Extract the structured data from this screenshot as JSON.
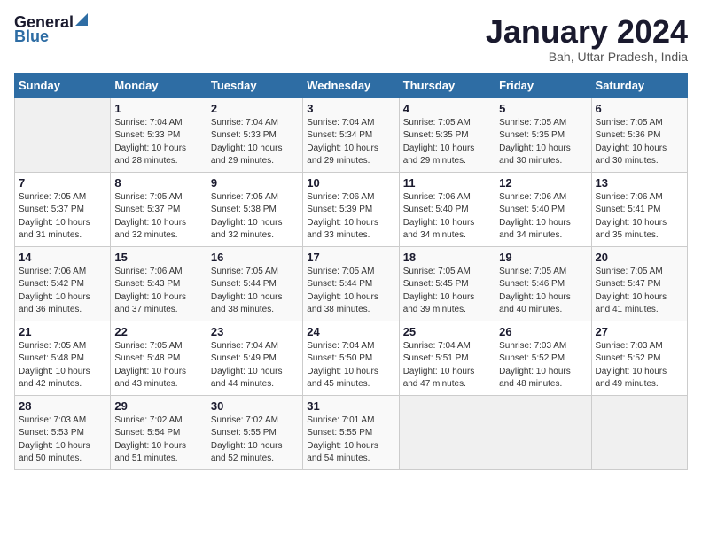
{
  "logo": {
    "general": "General",
    "blue": "Blue"
  },
  "header": {
    "month": "January 2024",
    "location": "Bah, Uttar Pradesh, India"
  },
  "columns": [
    "Sunday",
    "Monday",
    "Tuesday",
    "Wednesday",
    "Thursday",
    "Friday",
    "Saturday"
  ],
  "weeks": [
    [
      {
        "day": "",
        "sunrise": "",
        "sunset": "",
        "daylight": ""
      },
      {
        "day": "1",
        "sunrise": "Sunrise: 7:04 AM",
        "sunset": "Sunset: 5:33 PM",
        "daylight": "Daylight: 10 hours and 28 minutes."
      },
      {
        "day": "2",
        "sunrise": "Sunrise: 7:04 AM",
        "sunset": "Sunset: 5:33 PM",
        "daylight": "Daylight: 10 hours and 29 minutes."
      },
      {
        "day": "3",
        "sunrise": "Sunrise: 7:04 AM",
        "sunset": "Sunset: 5:34 PM",
        "daylight": "Daylight: 10 hours and 29 minutes."
      },
      {
        "day": "4",
        "sunrise": "Sunrise: 7:05 AM",
        "sunset": "Sunset: 5:35 PM",
        "daylight": "Daylight: 10 hours and 29 minutes."
      },
      {
        "day": "5",
        "sunrise": "Sunrise: 7:05 AM",
        "sunset": "Sunset: 5:35 PM",
        "daylight": "Daylight: 10 hours and 30 minutes."
      },
      {
        "day": "6",
        "sunrise": "Sunrise: 7:05 AM",
        "sunset": "Sunset: 5:36 PM",
        "daylight": "Daylight: 10 hours and 30 minutes."
      }
    ],
    [
      {
        "day": "7",
        "sunrise": "Sunrise: 7:05 AM",
        "sunset": "Sunset: 5:37 PM",
        "daylight": "Daylight: 10 hours and 31 minutes."
      },
      {
        "day": "8",
        "sunrise": "Sunrise: 7:05 AM",
        "sunset": "Sunset: 5:37 PM",
        "daylight": "Daylight: 10 hours and 32 minutes."
      },
      {
        "day": "9",
        "sunrise": "Sunrise: 7:05 AM",
        "sunset": "Sunset: 5:38 PM",
        "daylight": "Daylight: 10 hours and 32 minutes."
      },
      {
        "day": "10",
        "sunrise": "Sunrise: 7:06 AM",
        "sunset": "Sunset: 5:39 PM",
        "daylight": "Daylight: 10 hours and 33 minutes."
      },
      {
        "day": "11",
        "sunrise": "Sunrise: 7:06 AM",
        "sunset": "Sunset: 5:40 PM",
        "daylight": "Daylight: 10 hours and 34 minutes."
      },
      {
        "day": "12",
        "sunrise": "Sunrise: 7:06 AM",
        "sunset": "Sunset: 5:40 PM",
        "daylight": "Daylight: 10 hours and 34 minutes."
      },
      {
        "day": "13",
        "sunrise": "Sunrise: 7:06 AM",
        "sunset": "Sunset: 5:41 PM",
        "daylight": "Daylight: 10 hours and 35 minutes."
      }
    ],
    [
      {
        "day": "14",
        "sunrise": "Sunrise: 7:06 AM",
        "sunset": "Sunset: 5:42 PM",
        "daylight": "Daylight: 10 hours and 36 minutes."
      },
      {
        "day": "15",
        "sunrise": "Sunrise: 7:06 AM",
        "sunset": "Sunset: 5:43 PM",
        "daylight": "Daylight: 10 hours and 37 minutes."
      },
      {
        "day": "16",
        "sunrise": "Sunrise: 7:05 AM",
        "sunset": "Sunset: 5:44 PM",
        "daylight": "Daylight: 10 hours and 38 minutes."
      },
      {
        "day": "17",
        "sunrise": "Sunrise: 7:05 AM",
        "sunset": "Sunset: 5:44 PM",
        "daylight": "Daylight: 10 hours and 38 minutes."
      },
      {
        "day": "18",
        "sunrise": "Sunrise: 7:05 AM",
        "sunset": "Sunset: 5:45 PM",
        "daylight": "Daylight: 10 hours and 39 minutes."
      },
      {
        "day": "19",
        "sunrise": "Sunrise: 7:05 AM",
        "sunset": "Sunset: 5:46 PM",
        "daylight": "Daylight: 10 hours and 40 minutes."
      },
      {
        "day": "20",
        "sunrise": "Sunrise: 7:05 AM",
        "sunset": "Sunset: 5:47 PM",
        "daylight": "Daylight: 10 hours and 41 minutes."
      }
    ],
    [
      {
        "day": "21",
        "sunrise": "Sunrise: 7:05 AM",
        "sunset": "Sunset: 5:48 PM",
        "daylight": "Daylight: 10 hours and 42 minutes."
      },
      {
        "day": "22",
        "sunrise": "Sunrise: 7:05 AM",
        "sunset": "Sunset: 5:48 PM",
        "daylight": "Daylight: 10 hours and 43 minutes."
      },
      {
        "day": "23",
        "sunrise": "Sunrise: 7:04 AM",
        "sunset": "Sunset: 5:49 PM",
        "daylight": "Daylight: 10 hours and 44 minutes."
      },
      {
        "day": "24",
        "sunrise": "Sunrise: 7:04 AM",
        "sunset": "Sunset: 5:50 PM",
        "daylight": "Daylight: 10 hours and 45 minutes."
      },
      {
        "day": "25",
        "sunrise": "Sunrise: 7:04 AM",
        "sunset": "Sunset: 5:51 PM",
        "daylight": "Daylight: 10 hours and 47 minutes."
      },
      {
        "day": "26",
        "sunrise": "Sunrise: 7:03 AM",
        "sunset": "Sunset: 5:52 PM",
        "daylight": "Daylight: 10 hours and 48 minutes."
      },
      {
        "day": "27",
        "sunrise": "Sunrise: 7:03 AM",
        "sunset": "Sunset: 5:52 PM",
        "daylight": "Daylight: 10 hours and 49 minutes."
      }
    ],
    [
      {
        "day": "28",
        "sunrise": "Sunrise: 7:03 AM",
        "sunset": "Sunset: 5:53 PM",
        "daylight": "Daylight: 10 hours and 50 minutes."
      },
      {
        "day": "29",
        "sunrise": "Sunrise: 7:02 AM",
        "sunset": "Sunset: 5:54 PM",
        "daylight": "Daylight: 10 hours and 51 minutes."
      },
      {
        "day": "30",
        "sunrise": "Sunrise: 7:02 AM",
        "sunset": "Sunset: 5:55 PM",
        "daylight": "Daylight: 10 hours and 52 minutes."
      },
      {
        "day": "31",
        "sunrise": "Sunrise: 7:01 AM",
        "sunset": "Sunset: 5:55 PM",
        "daylight": "Daylight: 10 hours and 54 minutes."
      },
      {
        "day": "",
        "sunrise": "",
        "sunset": "",
        "daylight": ""
      },
      {
        "day": "",
        "sunrise": "",
        "sunset": "",
        "daylight": ""
      },
      {
        "day": "",
        "sunrise": "",
        "sunset": "",
        "daylight": ""
      }
    ]
  ]
}
